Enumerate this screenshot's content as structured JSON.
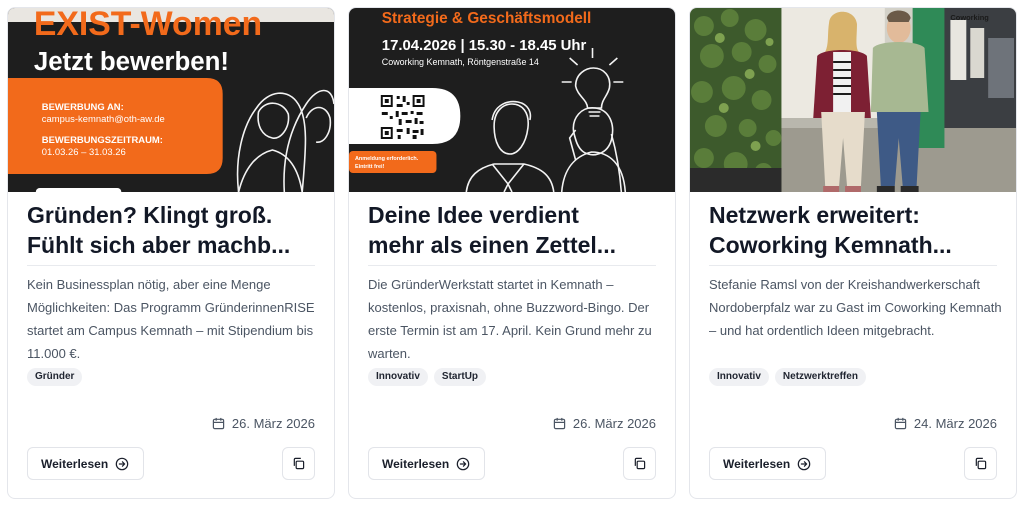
{
  "cards": [
    {
      "image": {
        "headline_1": "EXIST-Women",
        "headline_2": "Jetzt bewerben!",
        "label_apply": "BEWERBUNG AN:",
        "email": "campus-kemnath@oth-aw.de",
        "label_period": "BEWERBUNGSZEITRAUM:",
        "period": "01.03.26 – 31.03.26"
      },
      "title_line1": "Gründen? Klingt groß.",
      "title_line2": "Fühlt sich aber machb...",
      "excerpt": "Kein Businessplan nötig, aber eine Menge Möglichkeiten: Das Programm GründerinnenRISE startet am Campus Kemnath – mit Stipendium bis 11.000 €.",
      "tags": [
        "Gründer"
      ],
      "date": "26. März 2026",
      "read_more": "Weiterlesen"
    },
    {
      "image": {
        "headline": "Strategie & Geschäftsmodell",
        "datetime": "17.04.2026 | 15.30 - 18.45 Uhr",
        "location": "Coworking Kemnath, Röntgenstraße 14",
        "note_1": "Anmeldung erforderlich.",
        "note_2": "Eintritt frei!"
      },
      "title_line1": "Deine Idee verdient",
      "title_line2": "mehr als einen Zettel...",
      "excerpt": "Die GründerWerkstatt startet in Kemnath – kostenlos, praxisnah, ohne Buzzword-Bingo. Der erste Termin ist am 17. April. Kein Grund mehr zu warten.",
      "tags": [
        "Innovativ",
        "StartUp"
      ],
      "date": "26. März 2026",
      "read_more": "Weiterlesen"
    },
    {
      "image": {
        "sign": "Coworking"
      },
      "title_line1": "Netzwerk erweitert:",
      "title_line2": "Coworking Kemnath...",
      "excerpt": "Stefanie Ramsl von der Kreishandwerkerschaft Nordoberpfalz war zu Gast im Coworking Kemnath – und hat ordentlich Ideen mitgebracht.",
      "tags": [
        "Innovativ",
        "Netzwerktreffen"
      ],
      "date": "24. März 2026",
      "read_more": "Weiterlesen"
    }
  ],
  "colors": {
    "accent_orange": "#f26a1b",
    "dark_bg": "#1e1e1e"
  }
}
